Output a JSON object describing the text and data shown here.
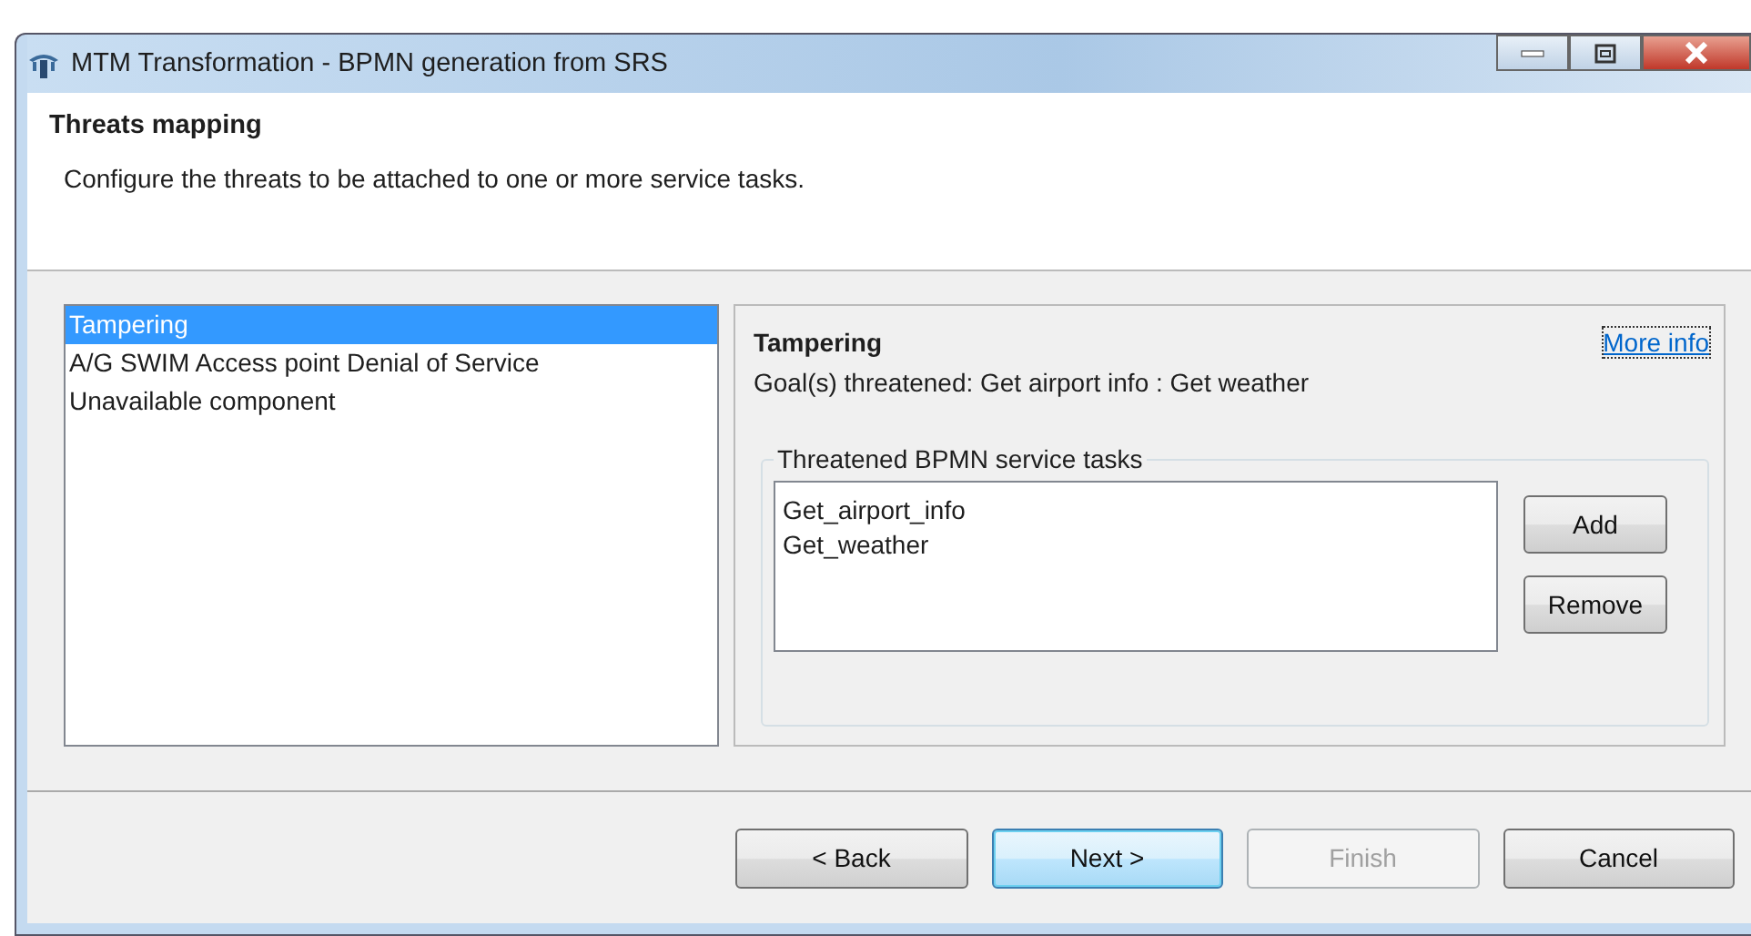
{
  "window": {
    "title": "MTM Transformation - BPMN generation from SRS"
  },
  "header": {
    "title": "Threats mapping",
    "description": "Configure the threats to be attached to one or more service tasks."
  },
  "threats": [
    {
      "label": "Tampering",
      "selected": true
    },
    {
      "label": "A/G SWIM Access point Denial of Service",
      "selected": false
    },
    {
      "label": "Unavailable component",
      "selected": false
    }
  ],
  "details": {
    "title": "Tampering",
    "link": "More info",
    "goals": "Goal(s) threatened: Get airport info : Get weather",
    "group": {
      "label": "Threatened BPMN service tasks",
      "tasks": [
        "Get_airport_info",
        "Get_weather"
      ],
      "buttons": [
        "Add",
        "Remove"
      ]
    }
  },
  "buttons": [
    {
      "label": "< Back",
      "disabled": false,
      "default": false
    },
    {
      "label": "Next >",
      "disabled": false,
      "default": true
    },
    {
      "label": "Finish",
      "disabled": true,
      "default": false
    },
    {
      "label": "Cancel",
      "disabled": false,
      "default": false
    }
  ]
}
